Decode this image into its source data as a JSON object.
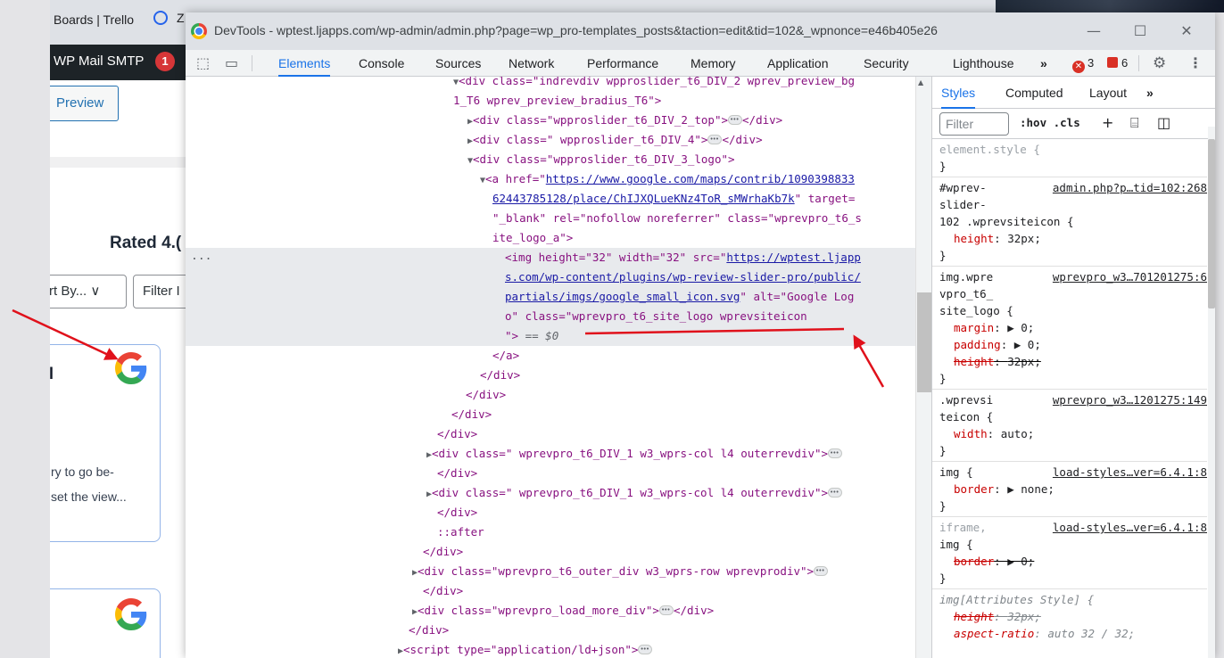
{
  "browser": {
    "tab1_label": "Boards | Trello",
    "tab2_label": "Z"
  },
  "wp": {
    "adminbar_item": "WP Mail SMTP",
    "adminbar_badge": "1",
    "preview_button": "Preview",
    "rated_text": "Rated 4.(",
    "sort_select": "rt By... ∨",
    "filter_select": "Filter I",
    "card_partial_heading": "l",
    "card_text_line1": "ry to go be-",
    "card_text_line2": "set the view..."
  },
  "devtools": {
    "window_title": "DevTools - wptest.ljapps.com/wp-admin/admin.php?page=wp_pro-templates_posts&taction=edit&tid=102&_wpnonce=e46b405e26",
    "window_controls": {
      "minimize": "—",
      "maximize": "☐",
      "close": "✕"
    },
    "tabs": [
      "Elements",
      "Console",
      "Sources",
      "Network",
      "Performance",
      "Memory",
      "Application",
      "Security",
      "Lighthouse",
      "»"
    ],
    "active_tab": "Elements",
    "error_count": "3",
    "warning_count": "6",
    "dom_tree": {
      "l1a": "<div class=\"indrevdiv wpproslider_t6_DIV_2 wprev_preview_bg",
      "l1b": "1_T6 wprev_preview_bradius_T6\">",
      "l2": "<div class=\"wpproslider_t6_DIV_2_top\">",
      "l3": "<div class=\" wpproslider_t6_DIV_4\">",
      "l4": "<div class=\"wpproslider_t6_DIV_3_logo\">",
      "a_open": "<a href=\"",
      "a_href_1": "https://www.google.com/maps/contrib/1090398833",
      "a_href_2": "62443785128/place/ChIJXQLueKNz4ToR_sMWrhaKb7k",
      "a_rest_1": "\" target=",
      "a_rest_2": "\"_blank\" rel=\"nofollow noreferrer\" class=\"wprevpro_t6_s",
      "a_rest_3": "ite_logo_a\">",
      "img_open": "<img height=\"32\" width=\"32\" src=\"",
      "img_src_1": "https://wptest.ljapp",
      "img_src_2": "s.com/wp-content/plugins/wp-review-slider-pro/public/",
      "img_src_3": "partials/imgs/google_small_icon.svg",
      "img_alt": "\" alt=\"Google Log",
      "img_class_1": "o\" class=\"wprevpro_t6_site_logo wprevsiteicon",
      "img_close": "\">",
      "img_eq": " == $0",
      "close_a": "</a>",
      "close_div": "</div>",
      "outer1": "<div class=\" wprevpro_t6_DIV_1 w3_wprs-col l4 outerrevdiv\">",
      "outer2": "<div class=\" wprevpro_t6_DIV_1 w3_wprs-col l4 outerrevdiv\">",
      "after": "::after",
      "outer_row": "<div class=\"wprevpro_t6_outer_div w3_wprs-row wprevprodiv\">",
      "load_more": "<div class=\"wprevpro_load_more_div\">",
      "script": "<script type=\"application/ld+json\">",
      "dots": "..."
    },
    "styles_pane": {
      "tabs": [
        "Styles",
        "Computed",
        "Layout",
        "»"
      ],
      "filter_placeholder": "Filter",
      "hov_cls": ":hov .cls",
      "rules": {
        "r1_sel": "element.style {",
        "r2_sel_1": "#wprev-",
        "r2_sel_2": "slider-",
        "r2_sel_3": "102 .wprevsiteicon {",
        "r2_src": "admin.php?p…tid=102:268",
        "r2_prop": "height",
        "r2_val": "32px;",
        "r3_sel_1": "img.wpre",
        "r3_sel_2": "vpro_t6_",
        "r3_sel_3": "site_logo {",
        "r3_src": "wprevpro_w3…701201275:6",
        "r3_p1": "margin",
        "r3_v1": "▶ 0;",
        "r3_p2": "padding",
        "r3_v2": "▶ 0;",
        "r3_p3": "height",
        "r3_v3": "32px;",
        "r4_sel_1": ".wprevsi",
        "r4_sel_2": "teicon {",
        "r4_src": "wprevpro_w3…1201275:149",
        "r4_prop": "width",
        "r4_val": "auto;",
        "r5_sel": "img {",
        "r5_src": "load-styles…ver=6.4.1:8",
        "r5_prop": "border",
        "r5_val": "▶ none;",
        "r6_sel_1": "iframe,",
        "r6_sel_2": "img {",
        "r6_src": "load-styles…ver=6.4.1:8",
        "r6_prop": "border",
        "r6_val": "▶ 0;",
        "r7_sel": "img[Attributes Style] {",
        "r7_p1": "height",
        "r7_v1": "32px;",
        "r7_p2": "aspect-ratio",
        "r7_v2": "auto 32 / 32;",
        "close": "}"
      }
    }
  },
  "colors": {
    "accent": "#1a73e8",
    "annotation_red": "#e0111b"
  }
}
